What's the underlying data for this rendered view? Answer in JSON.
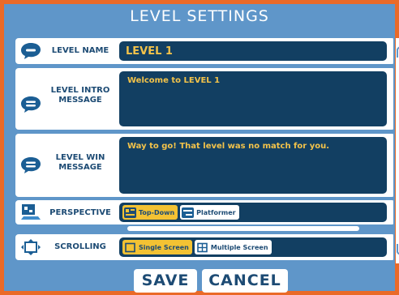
{
  "dialog": {
    "title": "LEVEL SETTINGS"
  },
  "fields": {
    "level_name": {
      "label": "LEVEL NAME",
      "value": "LEVEL 1",
      "icon": "speech-bubble-icon"
    },
    "intro": {
      "label": "LEVEL INTRO MESSAGE",
      "value": "Welcome to LEVEL 1",
      "icon": "speech-bubble-icon"
    },
    "win": {
      "label": "LEVEL WIN MESSAGE",
      "value": "Way to go! That level was no match for you.",
      "icon": "speech-bubble-icon"
    }
  },
  "perspective": {
    "label": "PERSPECTIVE",
    "icon": "perspective-icon",
    "options": [
      "Top-Down",
      "Platformer"
    ],
    "selected": "Top-Down"
  },
  "scrolling": {
    "label": "SCROLLING",
    "icon": "crosshair-arrows-icon",
    "options": [
      "Single Screen",
      "Multiple Screen"
    ],
    "selected": "Single Screen"
  },
  "buttons": {
    "save": "SAVE",
    "cancel": "CANCEL"
  },
  "colors": {
    "frame_border": "#ea6a28",
    "background": "#5f96c9",
    "field_bg": "#123f62",
    "accent_yellow": "#f3c233",
    "label_text": "#1d4b74"
  }
}
